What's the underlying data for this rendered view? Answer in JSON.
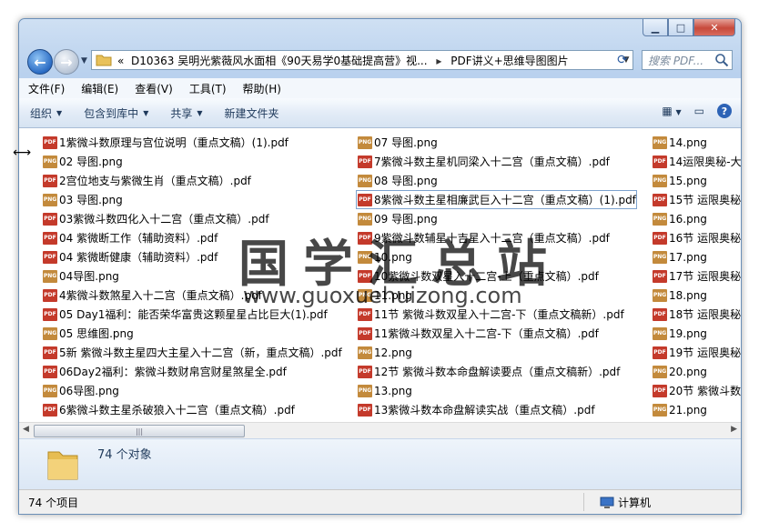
{
  "window": {
    "controls": [
      "minimize",
      "maximize",
      "close"
    ]
  },
  "address_bar": {
    "prefix": "«",
    "path_parent": "D10363 吴明光紫薇风水面相《90天易学0基础提高营》视...",
    "separator": "▸",
    "path_current": "PDF讲义+思维导图图片"
  },
  "search": {
    "placeholder": "搜索 PDF..."
  },
  "menu": [
    "文件(F)",
    "编辑(E)",
    "查看(V)",
    "工具(T)",
    "帮助(H)"
  ],
  "toolbar": {
    "organize": "组织",
    "include": "包含到库中",
    "share": "共享",
    "new_folder": "新建文件夹"
  },
  "columns": [
    [
      {
        "name": "1紫微斗数原理与宫位说明（重点文稿）(1).pdf",
        "type": "pdf"
      },
      {
        "name": "02 导图.png",
        "type": "png"
      },
      {
        "name": "2宫位地支与紫微生肖（重点文稿）.pdf",
        "type": "pdf"
      },
      {
        "name": "03 导图.png",
        "type": "png"
      },
      {
        "name": "03紫微斗数四化入十二宫（重点文稿）.pdf",
        "type": "pdf"
      },
      {
        "name": "04 紫微断工作（辅助资料）.pdf",
        "type": "pdf"
      },
      {
        "name": "04 紫微断健康（辅助资料）.pdf",
        "type": "pdf"
      },
      {
        "name": "04导图.png",
        "type": "png"
      },
      {
        "name": "4紫微斗数煞星入十二宫（重点文稿）.pdf",
        "type": "pdf"
      },
      {
        "name": "05 Day1福利：能否荣华富贵这颗星星占比巨大(1).pdf",
        "type": "pdf"
      },
      {
        "name": "05 思维图.png",
        "type": "png"
      },
      {
        "name": "5新 紫微斗数主星四大主星入十二宫（新，重点文稿）.pdf",
        "type": "pdf"
      },
      {
        "name": "06Day2福利：紫微斗数财帛宫财星煞星全.pdf",
        "type": "pdf"
      },
      {
        "name": "06导图.png",
        "type": "png"
      },
      {
        "name": "6紫微斗数主星杀破狼入十二宫（重点文稿）.pdf",
        "type": "pdf"
      }
    ],
    [
      {
        "name": "07 导图.png",
        "type": "png"
      },
      {
        "name": "7紫微斗数主星机同梁入十二宫（重点文稿）.pdf",
        "type": "pdf"
      },
      {
        "name": "08 导图.png",
        "type": "png"
      },
      {
        "name": "8紫微斗数主星相廉武巨入十二宫（重点文稿）(1).pdf",
        "type": "pdf",
        "selected": true
      },
      {
        "name": "09 导图.png",
        "type": "png"
      },
      {
        "name": "9紫微斗数辅星十吉星入十二宫（重点文稿）.pdf",
        "type": "pdf"
      },
      {
        "name": "10.png",
        "type": "png"
      },
      {
        "name": "10紫微斗数双星入十二宫-上（重点文稿）.pdf",
        "type": "pdf"
      },
      {
        "name": "11.png",
        "type": "png"
      },
      {
        "name": "11节 紫微斗数双星入十二宫-下（重点文稿新）.pdf",
        "type": "pdf"
      },
      {
        "name": "11紫微斗数双星入十二宫-下（重点文稿）.pdf",
        "type": "pdf"
      },
      {
        "name": "12.png",
        "type": "png"
      },
      {
        "name": "12节 紫微斗数本命盘解读要点（重点文稿新）.pdf",
        "type": "pdf"
      },
      {
        "name": "13.png",
        "type": "png"
      },
      {
        "name": "13紫微斗数本命盘解读实战（重点文稿）.pdf",
        "type": "pdf"
      }
    ],
    [
      {
        "name": "14.png",
        "type": "png"
      },
      {
        "name": "14运限奥秘-大",
        "type": "pdf"
      },
      {
        "name": "15.png",
        "type": "png"
      },
      {
        "name": "15节 运限奥秘",
        "type": "pdf"
      },
      {
        "name": "16.png",
        "type": "png"
      },
      {
        "name": "16节 运限奥秘",
        "type": "pdf"
      },
      {
        "name": "17.png",
        "type": "png"
      },
      {
        "name": "17节 运限奥秘",
        "type": "pdf"
      },
      {
        "name": "18.png",
        "type": "png"
      },
      {
        "name": "18节 运限奥秘",
        "type": "pdf"
      },
      {
        "name": "19.png",
        "type": "png"
      },
      {
        "name": "19节 运限奥秘",
        "type": "pdf"
      },
      {
        "name": "20.png",
        "type": "png"
      },
      {
        "name": "20节 紫微斗数",
        "type": "pdf"
      },
      {
        "name": "21.png",
        "type": "png"
      }
    ]
  ],
  "watermark": {
    "title": "国学汇总站",
    "url": "www.guoxuehuizong.com"
  },
  "details": {
    "object_count": "74 个对象"
  },
  "status": {
    "items": "74 个项目",
    "location": "计算机"
  }
}
